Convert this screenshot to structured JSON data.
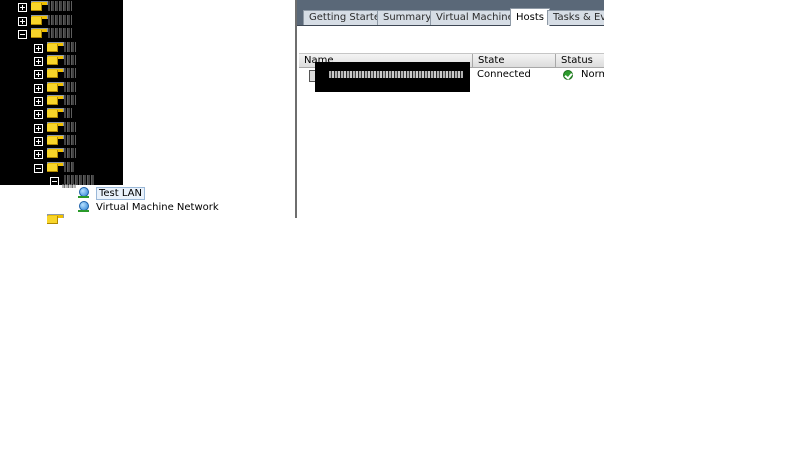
{
  "tabs": [
    {
      "label": "Getting Started"
    },
    {
      "label": "Summary"
    },
    {
      "label": "Virtual Machines"
    },
    {
      "label": "Hosts"
    },
    {
      "label": "Tasks & Even"
    }
  ],
  "grid": {
    "columns": [
      "Name",
      "State",
      "Status"
    ],
    "rows": [
      {
        "state": "Connected",
        "status": "Norm"
      }
    ]
  },
  "tree": {
    "networks": [
      {
        "label": "Test LAN"
      },
      {
        "label": "Virtual Machine Network"
      }
    ]
  },
  "colors": {
    "tab_bar": "#5a6878",
    "status_ok": "#2d9c2d",
    "folder": "#f8d52a"
  },
  "icons": [
    "folder-icon",
    "expander-icon",
    "network-icon",
    "host-icon",
    "status-ok-icon"
  ]
}
